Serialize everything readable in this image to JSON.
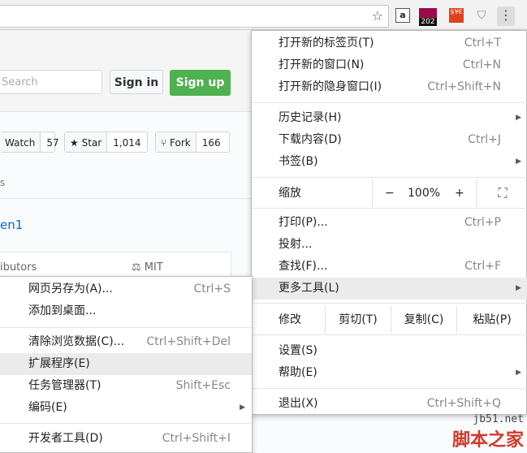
{
  "toolbar": {
    "star_icon": "star-icon",
    "ext_a": "a",
    "ext_badge": "202",
    "ext_red": "$¥€",
    "menu_icon": "⋮"
  },
  "page": {
    "search_placeholder": "Search",
    "signin": "Sign in",
    "signup": "Sign up",
    "watch_label": "Watch",
    "watch_count": "57",
    "star_label": "Star",
    "star_count": "1,014",
    "fork_label": "Fork",
    "fork_count": "166",
    "tab_fragment": "s",
    "repo_fragment": "en1",
    "contributors": "ibutors",
    "license": "MIT"
  },
  "main_menu": {
    "new_tab": {
      "label": "打开新的标签页(T)",
      "shortcut": "Ctrl+T"
    },
    "new_window": {
      "label": "打开新的窗口(N)",
      "shortcut": "Ctrl+N"
    },
    "incognito": {
      "label": "打开新的隐身窗口(I)",
      "shortcut": "Ctrl+Shift+N"
    },
    "history": {
      "label": "历史记录(H)"
    },
    "downloads": {
      "label": "下载内容(D)",
      "shortcut": "Ctrl+J"
    },
    "bookmarks": {
      "label": "书签(B)"
    },
    "zoom": {
      "label": "缩放",
      "minus": "−",
      "value": "100%",
      "plus": "+"
    },
    "print": {
      "label": "打印(P)...",
      "shortcut": "Ctrl+P"
    },
    "cast": {
      "label": "投射..."
    },
    "find": {
      "label": "查找(F)...",
      "shortcut": "Ctrl+F"
    },
    "more_tools": {
      "label": "更多工具(L)"
    },
    "edit": {
      "label": "修改",
      "cut": "剪切(T)",
      "copy": "复制(C)",
      "paste": "粘贴(P)"
    },
    "settings": {
      "label": "设置(S)"
    },
    "help": {
      "label": "帮助(E)"
    },
    "exit": {
      "label": "退出(X)",
      "shortcut": "Ctrl+Shift+Q"
    }
  },
  "sub_menu": {
    "save_as": {
      "label": "网页另存为(A)...",
      "shortcut": "Ctrl+S"
    },
    "add_desktop": {
      "label": "添加到桌面..."
    },
    "clear_data": {
      "label": "清除浏览数据(C)...",
      "shortcut": "Ctrl+Shift+Del"
    },
    "extensions": {
      "label": "扩展程序(E)"
    },
    "task_manager": {
      "label": "任务管理器(T)",
      "shortcut": "Shift+Esc"
    },
    "encoding": {
      "label": "编码(E)"
    },
    "devtools": {
      "label": "开发者工具(D)",
      "shortcut": "Ctrl+Shift+I"
    }
  },
  "watermark": {
    "url": "jb51.net",
    "name": "脚本之家"
  }
}
